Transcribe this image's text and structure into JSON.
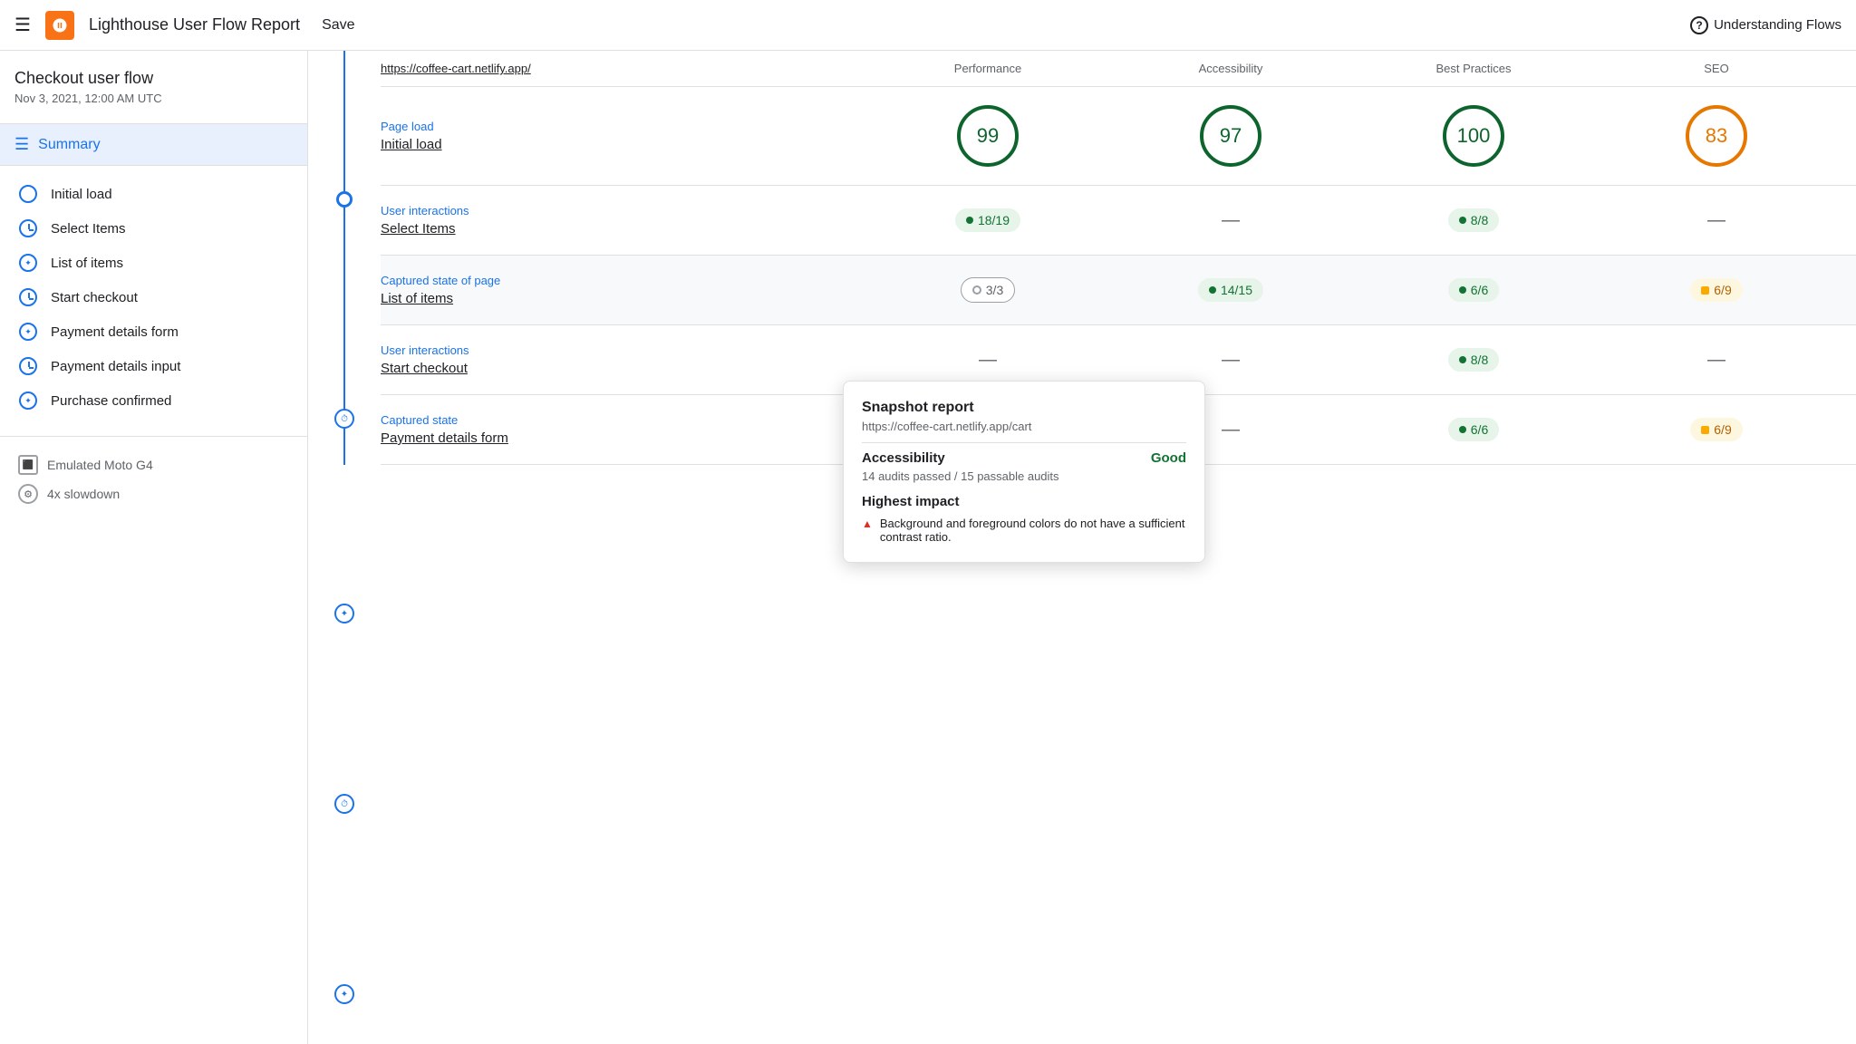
{
  "topbar": {
    "menu_label": "☰",
    "title": "Lighthouse User Flow Report",
    "save_label": "Save",
    "help_label": "Understanding Flows",
    "help_icon": "?"
  },
  "sidebar": {
    "flow_title": "Checkout user flow",
    "flow_date": "Nov 3, 2021, 12:00 AM UTC",
    "summary_label": "Summary",
    "steps": [
      {
        "label": "Initial load",
        "type": "load"
      },
      {
        "label": "Select Items",
        "type": "clock"
      },
      {
        "label": "List of items",
        "type": "snap"
      },
      {
        "label": "Start checkout",
        "type": "clock"
      },
      {
        "label": "Payment details form",
        "type": "snap"
      },
      {
        "label": "Payment details input",
        "type": "clock"
      },
      {
        "label": "Purchase confirmed",
        "type": "snap"
      }
    ],
    "meta": [
      {
        "label": "Emulated Moto G4",
        "icon": "device"
      },
      {
        "label": "4x slowdown",
        "icon": "gear"
      }
    ]
  },
  "table": {
    "col_url": "https://coffee-cart.netlify.app/",
    "col_perf": "Performance",
    "col_a11y": "Accessibility",
    "col_bp": "Best Practices",
    "col_seo": "SEO"
  },
  "rows": [
    {
      "type": "Page load",
      "name": "Initial load",
      "scores": {
        "perf": {
          "value": 99,
          "color": "green"
        },
        "a11y": {
          "value": 97,
          "color": "green"
        },
        "bp": {
          "value": 100,
          "color": "green"
        },
        "seo": {
          "value": 83,
          "color": "orange"
        }
      }
    },
    {
      "type": "User interactions",
      "name": "Select Items",
      "scores": {
        "perf": {
          "pill": "18/19",
          "type": "green"
        },
        "a11y": {
          "dash": true
        },
        "bp": {
          "pill": "8/8",
          "type": "green"
        },
        "seo": {
          "dash": true
        }
      }
    },
    {
      "type": "Captured state of page",
      "name": "List of items",
      "scores": {
        "perf": {
          "pill": "3/3",
          "type": "gray"
        },
        "a11y": {
          "pill": "14/15",
          "type": "green"
        },
        "bp": {
          "pill": "6/6",
          "type": "green"
        },
        "seo": {
          "pill": "6/9",
          "type": "orange-sq"
        }
      }
    },
    {
      "type": "User interactions",
      "name": "Start checkout",
      "scores": {
        "perf": {
          "dash": true
        },
        "a11y": {
          "dash": true
        },
        "bp": {
          "pill": "8/8",
          "type": "green"
        },
        "seo": {
          "dash": true
        }
      }
    },
    {
      "type": "Captured state",
      "name": "Payment details form",
      "scores": {
        "perf": {
          "dash": true
        },
        "a11y": {
          "dash": true
        },
        "bp": {
          "pill": "6/6",
          "type": "green"
        },
        "seo": {
          "pill": "6/9",
          "type": "orange-sq"
        }
      }
    }
  ],
  "tooltip": {
    "title": "Snapshot report",
    "url": "https://coffee-cart.netlify.app/cart",
    "section": "Accessibility",
    "section_status": "Good",
    "desc": "14 audits passed / 15 passable audits",
    "impact_title": "Highest impact",
    "impact_item": "Background and foreground colors do not have a sufficient contrast ratio."
  },
  "colors": {
    "blue": "#1a73e8",
    "green": "#0d652d",
    "green_light": "#137333",
    "orange": "#e67700",
    "red": "#d93025",
    "gray": "#5f6368"
  }
}
